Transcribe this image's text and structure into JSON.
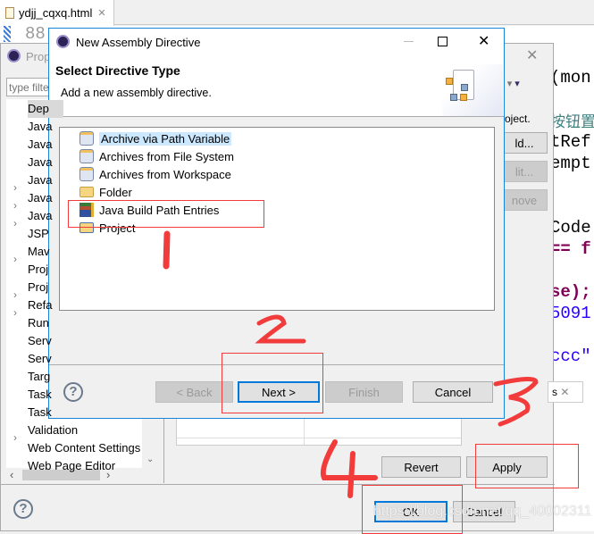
{
  "editor": {
    "tab_label": "ydjj_cqxq.html",
    "line_number": "88",
    "code_lines": [
      "(mon",
      "按钮置",
      "tRef",
      "empt",
      "Code",
      "== f",
      "se);",
      "5091",
      "ccc\""
    ]
  },
  "properties": {
    "title": "Prop",
    "filter_placeholder": "type filter text",
    "tree": [
      "Dep",
      "Java",
      "Java",
      "Java",
      "Java",
      "Java",
      "Java",
      "JSP",
      "Mav",
      "Proj",
      "Proj",
      "Refa",
      "Run",
      "Serv",
      "Serv",
      "Targ",
      "Task",
      "Task",
      "Validation",
      "Web Content Settings",
      "Web Page Editor"
    ],
    "expandable": [
      false,
      false,
      true,
      true,
      true,
      false,
      true,
      false,
      true,
      true,
      false,
      false,
      false,
      false,
      false,
      false,
      true,
      false,
      true,
      false,
      false
    ],
    "selected_index": 0,
    "desc_fragment": "oject.",
    "add_label": "ld...",
    "edit_label": "lit...",
    "remove_label": "nove",
    "tab_fragment": "s",
    "revert_label": "Revert",
    "apply_label": "Apply",
    "ok_label": "OK",
    "cancel_label": "Cancel"
  },
  "dialog": {
    "title": "New Assembly Directive",
    "heading": "Select Directive Type",
    "description": "Add a new assembly directive.",
    "items": [
      {
        "label": "Archive via Path Variable",
        "icon": "jar-icon",
        "selected": true
      },
      {
        "label": "Archives from File System",
        "icon": "jar-icon"
      },
      {
        "label": "Archives from Workspace",
        "icon": "jar-icon"
      },
      {
        "label": "Folder",
        "icon": "folder-icon"
      },
      {
        "label": "Java Build Path Entries",
        "icon": "library-icon"
      },
      {
        "label": "Project",
        "icon": "project-folder-icon"
      }
    ],
    "back_label": "< Back",
    "next_label": "Next >",
    "finish_label": "Finish",
    "cancel_label": "Cancel"
  },
  "annotations": {
    "steps": [
      "1",
      "2",
      "3",
      "4"
    ],
    "color": "#f23b3b"
  },
  "watermark": "https://blog.csdn.net/qq_40002311",
  "colors": {
    "accent": "#0078d7",
    "selection": "#cce8ff"
  }
}
